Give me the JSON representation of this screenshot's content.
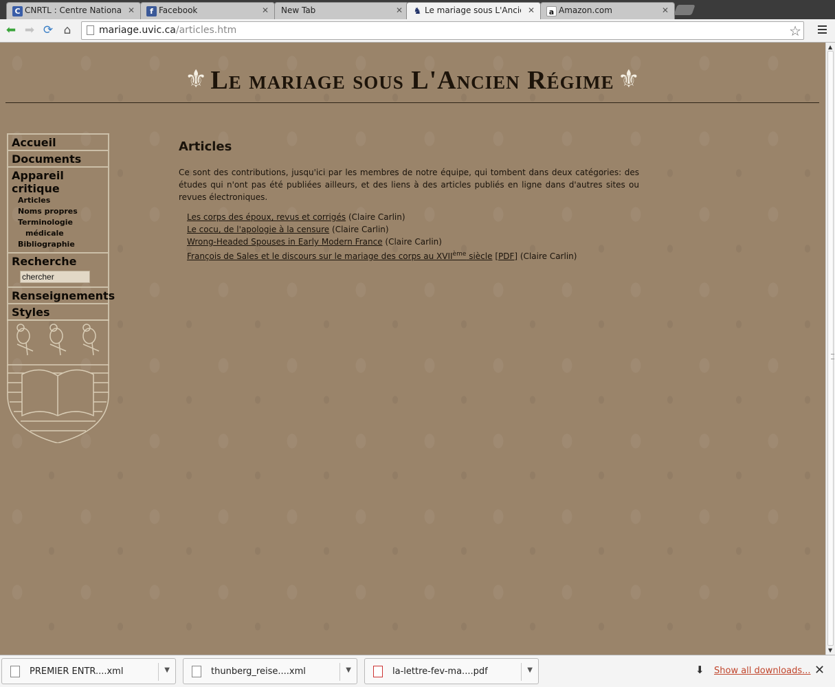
{
  "browser": {
    "tabs": [
      {
        "title": "CNRTL : Centre National de",
        "favicon": "cnrtl-icon",
        "favicon_color": "#3a5ea8"
      },
      {
        "title": "Facebook",
        "favicon": "facebook-icon",
        "favicon_color": "#3b5998"
      },
      {
        "title": "New Tab",
        "favicon": "",
        "favicon_color": ""
      },
      {
        "title": "Le mariage sous L'Ancien Régime",
        "favicon": "site-icon",
        "favicon_color": "#1e2f66"
      },
      {
        "title": "Amazon.com",
        "favicon": "amazon-icon",
        "favicon_color": "#ff9900"
      }
    ],
    "url_domain": "mariage.uvic.ca",
    "url_path": "/articles.htm"
  },
  "site": {
    "title": "Le mariage sous L'Ancien Régime",
    "fleur_glyph": "⚜"
  },
  "sidebar": {
    "accueil": "Accueil",
    "documents": "Documents",
    "appareil_critique": "Appareil critique",
    "sub": {
      "articles": "Articles",
      "noms_propres": "Noms propres",
      "terminologie": "Terminologie",
      "medicale": "médicale",
      "bibliographie": "Bibliographie"
    },
    "recherche": "Recherche",
    "search_value": "chercher",
    "renseignements": "Renseignements",
    "styles": "Styles"
  },
  "content": {
    "heading": "Articles",
    "intro": "Ce sont des contributions, jusqu'ici par les membres de notre équipe, qui tombent dans deux catégories: des études qui n'ont pas été publiées ailleurs, et des liens à des articles publiés en ligne dans d'autres sites ou revues électroniques.",
    "articles": [
      {
        "link": "Les corps des époux, revus et corrigés",
        "author": " (Claire Carlin)"
      },
      {
        "link": "Le cocu, de l'apologie à la censure",
        "author": " (Claire Carlin)"
      },
      {
        "link": "Wrong-Headed Spouses in Early Modern France",
        "author": " (Claire Carlin)"
      }
    ],
    "article4": {
      "link_start": "François de Sales et le discours sur le mariage des corps au XVII",
      "sup": "ème",
      "link_end": " siècle",
      "pdf": "[PDF]",
      "author": " (Claire Carlin)"
    }
  },
  "downloads": {
    "items": [
      {
        "name": "PREMIER ENTR....xml",
        "type": "file"
      },
      {
        "name": "thunberg_reise....xml",
        "type": "file"
      },
      {
        "name": "la-lettre-fev-ma....pdf",
        "type": "pdf"
      }
    ],
    "show_all": "Show all downloads..."
  },
  "colors": {
    "page_bg": "#9a846a",
    "title_text": "#1d140a",
    "fleur": "#f5f0e4",
    "nav_border": "#cbbfa8",
    "show_all_link": "#c1462d"
  }
}
